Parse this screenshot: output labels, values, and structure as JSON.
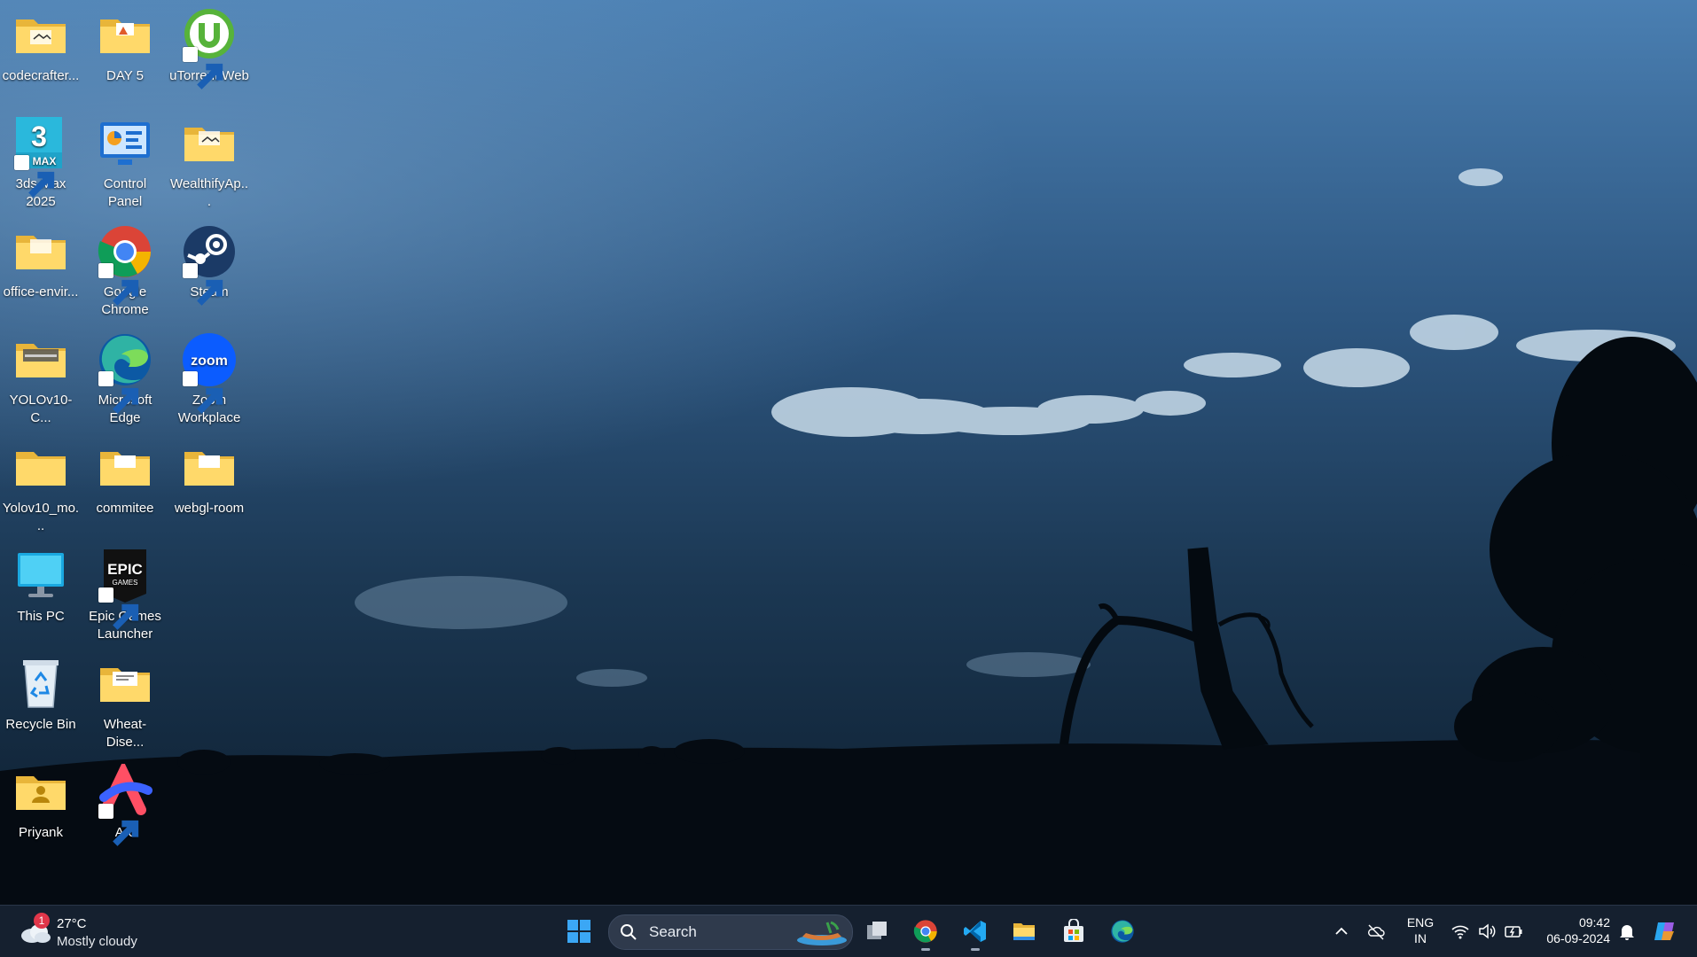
{
  "desktop": {
    "icons": [
      {
        "label": "codecrafter...",
        "icon": "folder-icon"
      },
      {
        "label": "DAY 5",
        "icon": "folder-icon"
      },
      {
        "label": "uTorrent Web",
        "icon": "utorrent-icon"
      },
      {
        "label": "3ds Max 2025",
        "icon": "3ds-max-icon",
        "badge": "3",
        "badge_sub": "MAX"
      },
      {
        "label": "Control Panel",
        "icon": "control-panel-icon"
      },
      {
        "label": "WealthifyAp...",
        "icon": "folder-icon"
      },
      {
        "label": "office-envir...",
        "icon": "folder-icon"
      },
      {
        "label": "Google Chrome",
        "icon": "chrome-icon"
      },
      {
        "label": "Steam",
        "icon": "steam-icon"
      },
      {
        "label": "YOLOv10-C...",
        "icon": "folder-icon"
      },
      {
        "label": "Microsoft Edge",
        "icon": "edge-icon"
      },
      {
        "label": "Zoom Workplace",
        "icon": "zoom-icon",
        "badge": "zoom"
      },
      {
        "label": "Yolov10_mo...",
        "icon": "folder-icon"
      },
      {
        "label": "commitee",
        "icon": "folder-icon"
      },
      {
        "label": "webgl-room",
        "icon": "folder-icon"
      },
      {
        "label": "This PC",
        "icon": "monitor-icon"
      },
      {
        "label": "Epic Games Launcher",
        "icon": "epic-games-icon",
        "badge": "EPIC",
        "badge_sub": "GAMES"
      },
      {
        "label": "Recycle Bin",
        "icon": "recycle-bin-icon"
      },
      {
        "label": "Wheat-Dise...",
        "icon": "folder-icon"
      },
      {
        "label": "Priyank",
        "icon": "user-folder-icon"
      },
      {
        "label": "Arc",
        "icon": "arc-icon"
      }
    ]
  },
  "taskbar": {
    "weather": {
      "temp": "27°C",
      "desc": "Mostly cloudy",
      "badge": "1",
      "icon": "cloud-icon"
    },
    "search_placeholder": "Search",
    "pinned": [
      {
        "name": "start",
        "icon": "windows-logo-icon"
      },
      {
        "name": "task-view",
        "icon": "task-view-icon"
      },
      {
        "name": "chrome",
        "icon": "chrome-icon",
        "running": true
      },
      {
        "name": "vscode",
        "icon": "vscode-icon",
        "running": true
      },
      {
        "name": "file-explorer",
        "icon": "folder-icon",
        "running": false
      },
      {
        "name": "microsoft-store",
        "icon": "store-icon",
        "running": false
      },
      {
        "name": "edge",
        "icon": "edge-icon",
        "running": false
      }
    ],
    "tray": {
      "lang_line1": "ENG",
      "lang_line2": "IN",
      "time": "09:42",
      "date": "06-09-2024"
    }
  },
  "colors": {
    "folder": "#f4c84a",
    "folder_front": "#ffd96a",
    "taskbar": "#162030",
    "accent": "#2f8de4"
  }
}
